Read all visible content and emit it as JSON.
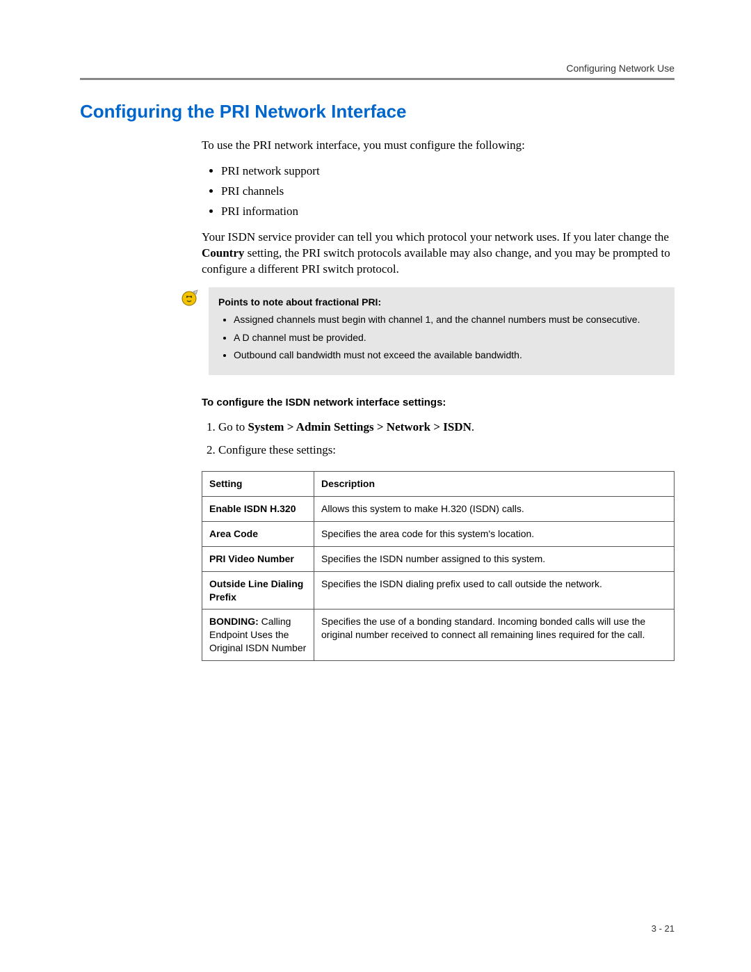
{
  "header": {
    "right": "Configuring Network Use"
  },
  "title": "Configuring the PRI Network Interface",
  "intro": "To use the PRI network interface, you must configure the following:",
  "introBullets": [
    "PRI network support",
    "PRI channels",
    "PRI information"
  ],
  "providerPara": {
    "pre": "Your ISDN service provider can tell you which protocol your network uses. If you later change the ",
    "bold": "Country",
    "post": " setting, the PRI switch protocols available may also change, and you may be prompted to configure a different PRI switch protocol."
  },
  "note": {
    "heading": "Points to note about fractional PRI:",
    "items": [
      "Assigned channels must begin with channel 1, and the channel numbers must be consecutive.",
      "A D channel must be provided.",
      "Outbound call bandwidth must not exceed the available bandwidth."
    ]
  },
  "subheading": "To configure the ISDN network interface settings:",
  "steps": {
    "s1pre": "Go to ",
    "s1bold": "System > Admin Settings > Network > ISDN",
    "s1post": ".",
    "s2": "Configure these settings:"
  },
  "table": {
    "headSetting": "Setting",
    "headDesc": "Description",
    "rows": [
      {
        "settingBold": "Enable ISDN H.320",
        "settingPlain": "",
        "desc": "Allows this system to make H.320 (ISDN) calls."
      },
      {
        "settingBold": "Area Code",
        "settingPlain": "",
        "desc": "Specifies the area code for this system's location."
      },
      {
        "settingBold": "PRI Video Number",
        "settingPlain": "",
        "desc": "Specifies the ISDN number assigned to this system."
      },
      {
        "settingBold": "Outside Line Dialing Prefix",
        "settingPlain": "",
        "desc": "Specifies the ISDN dialing prefix used to call outside the network."
      },
      {
        "settingBold": "BONDING:",
        "settingPlain": " Calling Endpoint Uses the Original ISDN Number",
        "desc": "Specifies the use of a bonding standard. Incoming bonded calls will use the original number received to connect all remaining lines required for the call."
      }
    ]
  },
  "pageNumber": "3 - 21"
}
